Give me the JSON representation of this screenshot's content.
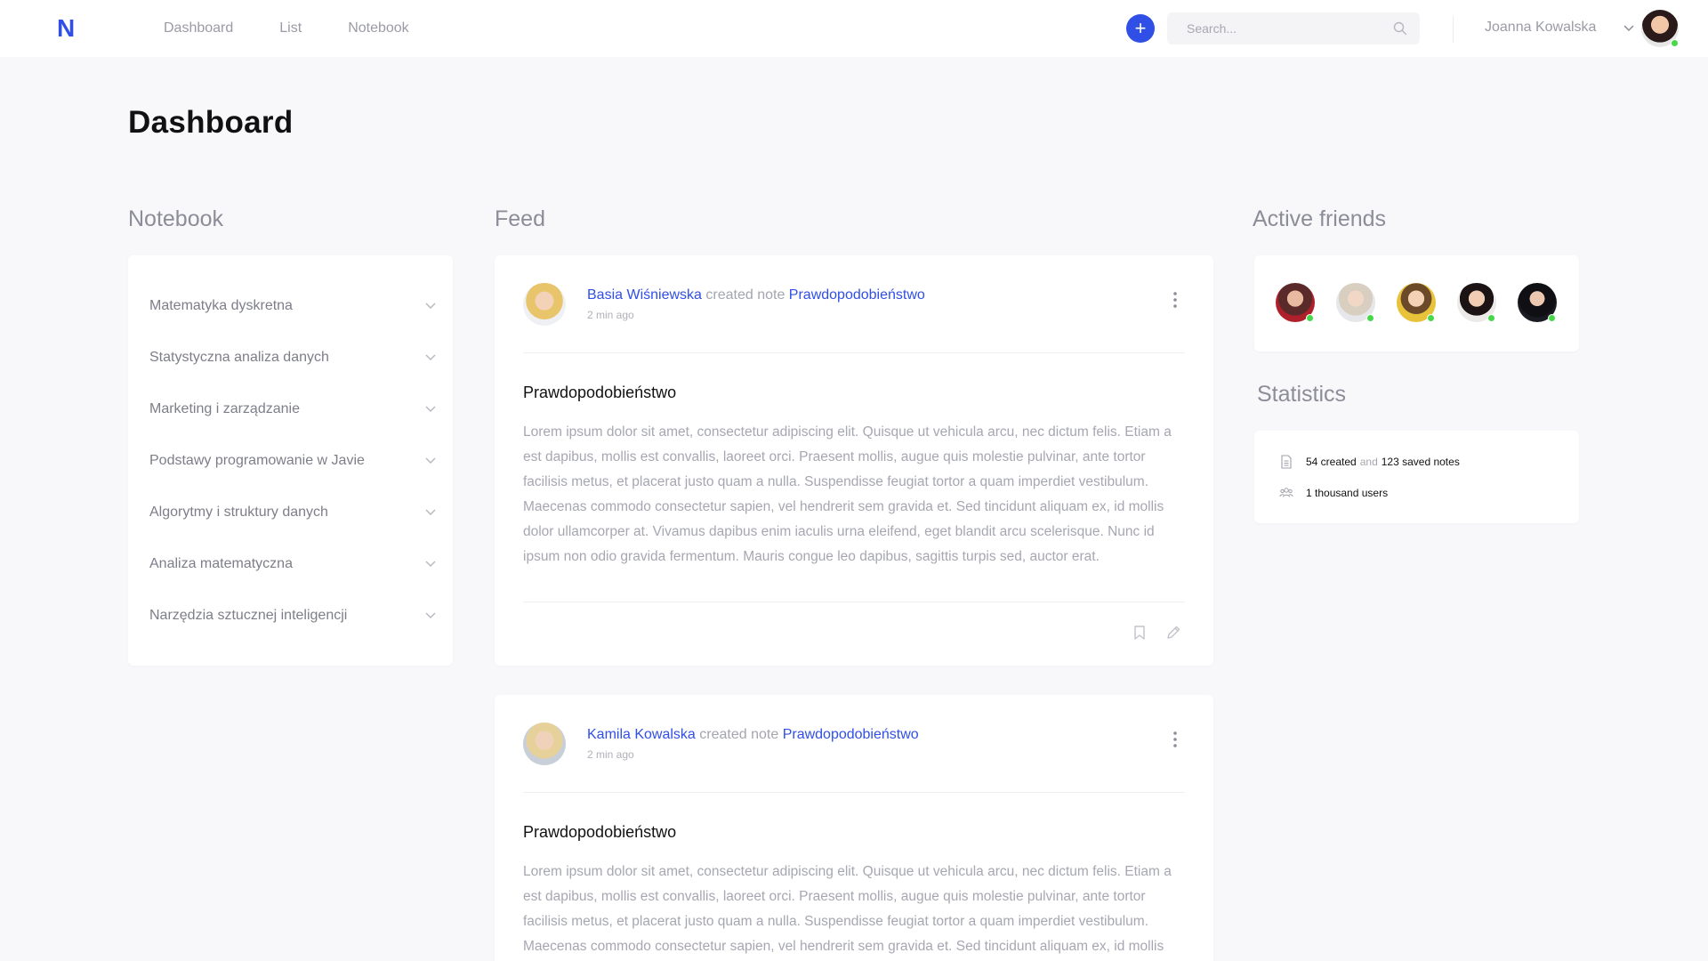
{
  "brand": {
    "logo_letter": "N",
    "accent": "#2f4fe6"
  },
  "nav": {
    "items": [
      {
        "label": "Dashboard"
      },
      {
        "label": "List"
      },
      {
        "label": "Notebook"
      }
    ]
  },
  "add_button": {
    "icon": "plus-icon",
    "glyph": "+"
  },
  "search": {
    "placeholder": "Search...",
    "value": "",
    "icon": "search-icon"
  },
  "user": {
    "name": "Joanna Kowalska",
    "status": "online"
  },
  "page": {
    "title": "Dashboard"
  },
  "notebook": {
    "title": "Notebook",
    "items": [
      {
        "label": "Matematyka dyskretna"
      },
      {
        "label": "Statystyczna analiza danych"
      },
      {
        "label": "Marketing i zarządzanie"
      },
      {
        "label": "Podstawy programowanie w Javie"
      },
      {
        "label": "Algorytmy i struktury danych"
      },
      {
        "label": "Analiza matematyczna"
      },
      {
        "label": "Narzędzia sztucznej inteligencji"
      }
    ]
  },
  "feed": {
    "title": "Feed",
    "posts": [
      {
        "author": "Basia Wiśniewska",
        "action": "created note",
        "note_link": "Prawdopodobieństwo",
        "time": "2 min ago",
        "title": "Prawdopodobieństwo",
        "body": "Lorem ipsum dolor sit amet, consectetur adipiscing elit. Quisque ut vehicula arcu, nec dictum felis. Etiam a est dapibus, mollis est convallis, laoreet orci. Praesent mollis, augue quis molestie pulvinar, ante tortor facilisis metus, et placerat justo quam a nulla. Suspendisse feugiat tortor a quam imperdiet vestibulum. Maecenas commodo consectetur sapien, vel hendrerit sem gravida et. Sed tincidunt aliquam ex, id mollis dolor ullamcorper at. Vivamus dapibus enim iaculis urna eleifend, eget blandit arcu scelerisque. Nunc id ipsum non odio gravida fermentum. Mauris congue leo dapibus, sagittis turpis sed, auctor erat."
      },
      {
        "author": "Kamila Kowalska",
        "action": "created note",
        "note_link": "Prawdopodobieństwo",
        "time": "2 min ago",
        "title": "Prawdopodobieństwo",
        "body": "Lorem ipsum dolor sit amet, consectetur adipiscing elit. Quisque ut vehicula arcu, nec dictum felis. Etiam a est dapibus, mollis est convallis, laoreet orci. Praesent mollis, augue quis molestie pulvinar, ante tortor facilisis metus, et placerat justo quam a nulla. Suspendisse feugiat tortor a quam imperdiet vestibulum. Maecenas commodo consectetur sapien, vel hendrerit sem gravida et. Sed tincidunt aliquam ex, id mollis"
      }
    ]
  },
  "friends": {
    "title": "Active friends",
    "count_online": 5
  },
  "statistics": {
    "title": "Statistics",
    "created": "54 created",
    "and": "and",
    "saved": "123 saved notes",
    "users": "1 thousand users"
  },
  "colors": {
    "online": "#47d84a",
    "link": "#2f4fe6",
    "muted": "#a6a7b1"
  }
}
